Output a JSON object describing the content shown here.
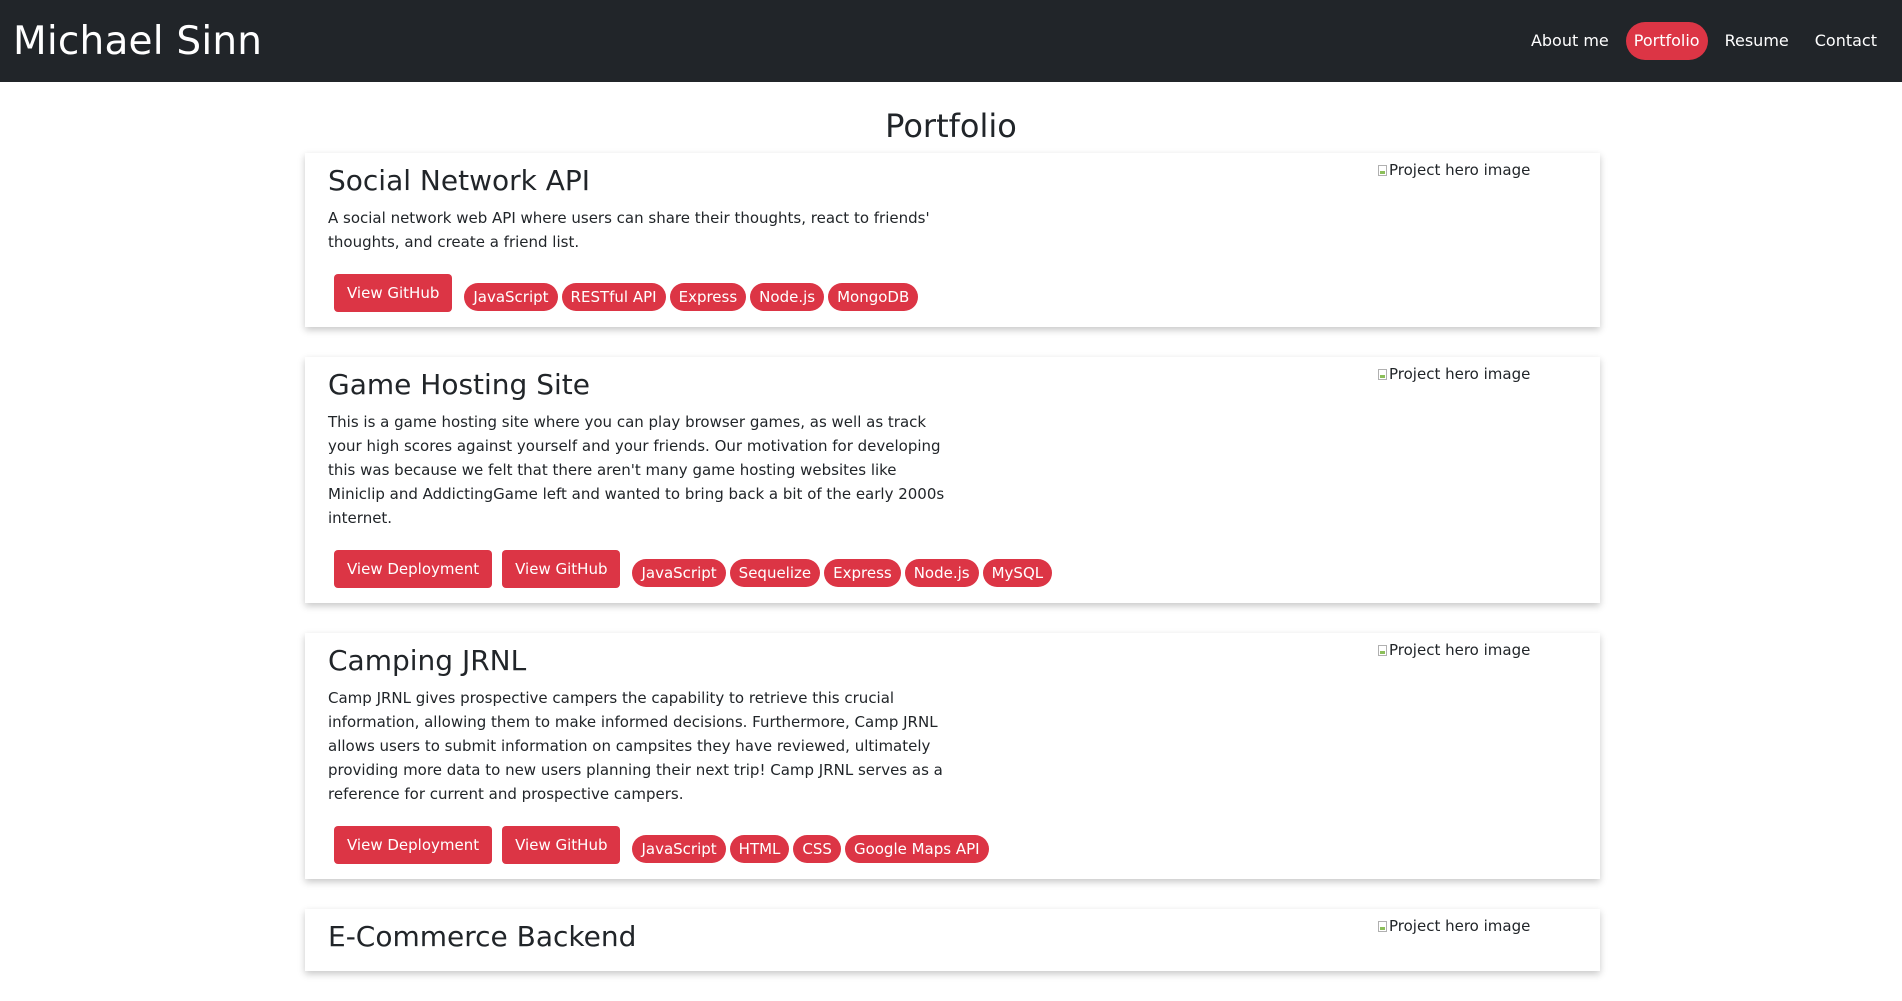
{
  "navbar": {
    "brand": "Michael Sinn",
    "links": [
      {
        "label": "About me"
      },
      {
        "label": "Portfolio"
      },
      {
        "label": "Resume"
      },
      {
        "label": "Contact"
      }
    ]
  },
  "page_title": "Portfolio",
  "hero_alt_text": "Project hero image",
  "colors": {
    "navbar_bg": "#212529",
    "accent": "#dc3545",
    "text": "#212529"
  },
  "projects": [
    {
      "title": "Social Network API",
      "description": "A social network web API where users can share their thoughts, react to friends' thoughts, and create a friend list.",
      "buttons": [
        "View GitHub"
      ],
      "tags": [
        "JavaScript",
        "RESTful API",
        "Express",
        "Node.js",
        "MongoDB"
      ]
    },
    {
      "title": "Game Hosting Site",
      "description": "This is a game hosting site where you can play browser games, as well as track your high scores against yourself and your friends. Our motivation for developing this was because we felt that there aren't many game hosting websites like Miniclip and AddictingGame left and wanted to bring back a bit of the early 2000s internet.",
      "buttons": [
        "View Deployment",
        "View GitHub"
      ],
      "tags": [
        "JavaScript",
        "Sequelize",
        "Express",
        "Node.js",
        "MySQL"
      ]
    },
    {
      "title": "Camping JRNL",
      "description": "Camp JRNL gives prospective campers the capability to retrieve this crucial information, allowing them to make informed decisions. Furthermore, Camp JRNL allows users to submit information on campsites they have reviewed, ultimately providing more data to new users planning their next trip! Camp JRNL serves as a reference for current and prospective campers.",
      "buttons": [
        "View Deployment",
        "View GitHub"
      ],
      "tags": [
        "JavaScript",
        "HTML",
        "CSS",
        "Google Maps API"
      ]
    },
    {
      "title": "E-Commerce Backend",
      "description": "",
      "buttons": [],
      "tags": []
    }
  ]
}
